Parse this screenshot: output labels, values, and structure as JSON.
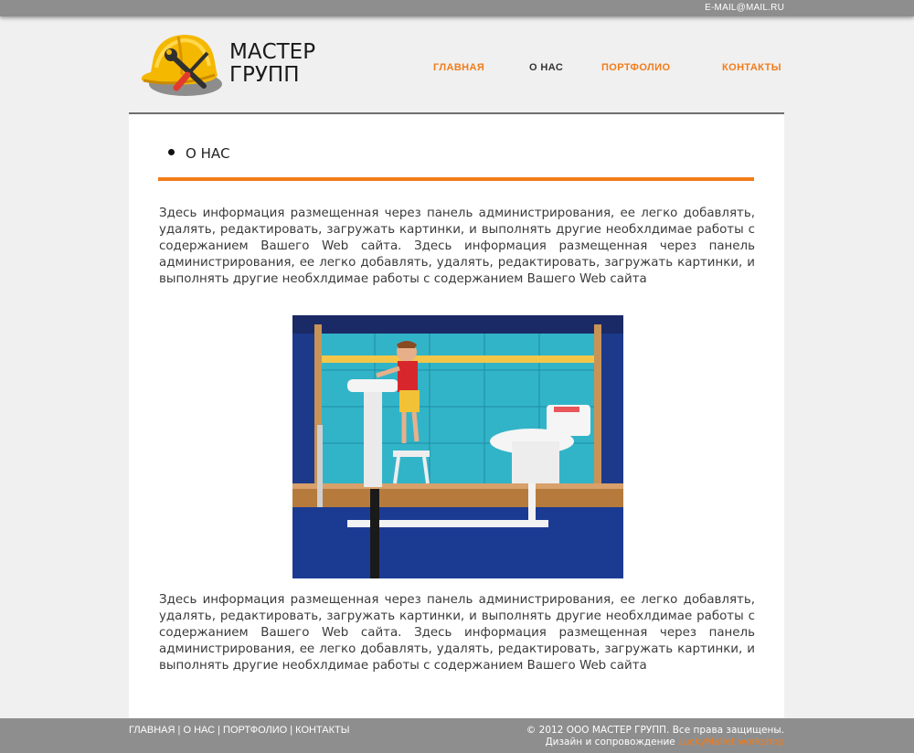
{
  "topbar": {
    "email": "E-MAIL@MAIL.RU"
  },
  "brand": {
    "line1": "МАСТЕР",
    "line2": "ГРУПП"
  },
  "nav": [
    {
      "label": "ГЛАВНАЯ",
      "active": false
    },
    {
      "label": "О НАС",
      "active": true
    },
    {
      "label": "ПОРТФОЛИО",
      "active": false
    },
    {
      "label": "КОНТАКТЫ",
      "active": false
    }
  ],
  "section": {
    "title": "О НАС"
  },
  "paragraphs": [
    "Здесь информация размещенная через панель администрирования, ее легко добавлять, удалять, редактировать, загружать картинки, и выполнять другие необхлдимае работы с содержанием Вашего Web сайта. Здесь информация размещенная через панель администрирования, ее легко добавлять, удалять, редактировать, загружать картинки, и выполнять другие необхлдимае работы с содержанием Вашего Web сайта",
    "Здесь информация размещенная через панель администрирования, ее легко добавлять, удалять, редактировать, загружать картинки, и выполнять другие необхлдимае работы с содержанием Вашего Web сайта. Здесь информация размещенная через панель администрирования, ее легко добавлять, удалять, редактировать, загружать картинки, и выполнять другие необхлдимае работы с содержанием Вашего Web сайта"
  ],
  "footer": {
    "links": [
      "ГЛАВНАЯ",
      "О НАС",
      "ПОРТФОЛИО",
      "КОНТАКТЫ"
    ],
    "separator": " | ",
    "copyright": "© 2012 ООО МАСТЕР ГРУПП. Все права защищены.",
    "credit_prefix": "Дизайн и сопровождение ",
    "credit_name": "LuckyMallet workshop"
  },
  "colors": {
    "accent": "#f27c1a",
    "bar": "#8e8e8e",
    "background": "#f0f0f0"
  },
  "icons": [
    "hardhat-logo-icon",
    "wrench-icon",
    "screwdriver-icon",
    "bullet-icon"
  ]
}
